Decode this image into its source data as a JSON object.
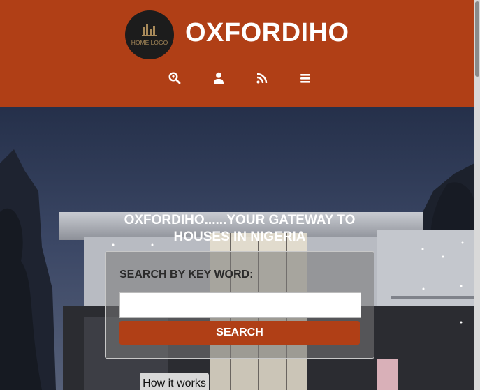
{
  "header": {
    "logo_text": "HOME LOGO",
    "brand": "OXFORDIHO",
    "nav_icons": [
      "search-location-icon",
      "user-icon",
      "rss-icon",
      "menu-icon"
    ]
  },
  "hero": {
    "tagline_line1": "OXFORDIHO......YOUR GATEWAY TO",
    "tagline_line2": "HOUSES IN NIGERIA"
  },
  "search": {
    "label": "SEARCH BY KEY WORD:",
    "value": "",
    "placeholder": "",
    "button": "SEARCH"
  },
  "how_it_works": "How it works",
  "colors": {
    "brand": "#b03f16",
    "header_bg": "#b03f16"
  }
}
